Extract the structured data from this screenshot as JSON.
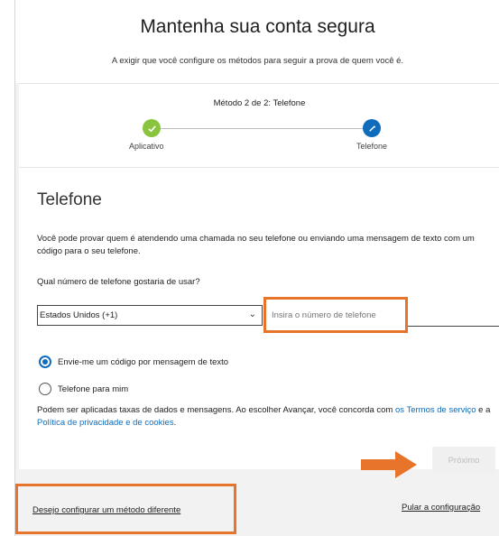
{
  "header": {
    "title": "Mantenha sua conta segura",
    "subtitle": "A exigir que você configure os métodos para seguir a prova de quem você é."
  },
  "progress": {
    "method_label": "Método 2 de 2: Telefone",
    "steps": [
      {
        "label": "Aplicativo",
        "state": "complete",
        "icon": "check-icon"
      },
      {
        "label": "Telefone",
        "state": "current",
        "icon": "pencil-icon"
      }
    ]
  },
  "section": {
    "title": "Telefone",
    "description": "Você pode provar quem é atendendo uma chamada no seu telefone ou enviando uma mensagem de texto com um código para o seu telefone.",
    "question": "Qual número de telefone gostaria de usar?"
  },
  "form": {
    "country_value": "Estados Unidos (+1)",
    "phone_placeholder": "Insira o número de telefone",
    "options": [
      {
        "label": "Envie-me um código por mensagem de texto",
        "checked": true
      },
      {
        "label": "Telefone para mim",
        "checked": false
      }
    ]
  },
  "terms": {
    "text_before": "Podem ser aplicadas taxas de dados e mensagens. Ao escolher Avançar, você concorda com ",
    "link1": "os Termos de serviço",
    "text_middle": " e a ",
    "link2": "Política de privacidade e de cookies",
    "text_after": "."
  },
  "buttons": {
    "next": "Próximo"
  },
  "footer": {
    "different_method": "Desejo configurar um método diferente",
    "skip": "Pular a configuração"
  },
  "colors": {
    "accent": "#0f6cbd",
    "success": "#8ac33e",
    "highlight": "#e8742b"
  }
}
